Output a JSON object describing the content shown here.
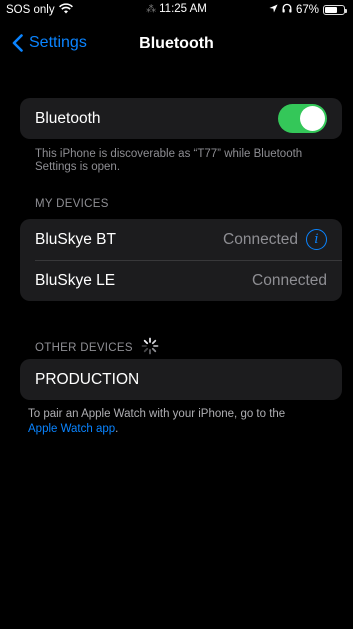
{
  "status_bar": {
    "carrier": "SOS only",
    "time": "11:25 AM",
    "battery_percent": "67%",
    "battery_level": 0.67,
    "icons": [
      "wifi-icon",
      "location-arrow-icon",
      "headphones-icon",
      "battery-icon"
    ]
  },
  "nav": {
    "back_label": "Settings",
    "title": "Bluetooth"
  },
  "bluetooth": {
    "label": "Bluetooth",
    "enabled": true,
    "discoverable_note": "This iPhone is discoverable as “T77” while Bluetooth Settings is open."
  },
  "my_devices": {
    "header": "MY DEVICES",
    "items": [
      {
        "name": "BluSkye BT",
        "status": "Connected",
        "has_info": true
      },
      {
        "name": "BluSkye LE",
        "status": "Connected",
        "has_info": false
      }
    ]
  },
  "other_devices": {
    "header": "OTHER DEVICES",
    "items": [
      {
        "name": "PRODUCTION"
      }
    ]
  },
  "pair_note": {
    "text": "To pair an Apple Watch with your iPhone, go to the",
    "link": "Apple Watch app",
    "end": "."
  },
  "colors": {
    "accent": "#0a84ff",
    "toggle_on": "#34c759",
    "cell_bg": "#1c1c1e",
    "secondary_text": "#8e8e93"
  }
}
